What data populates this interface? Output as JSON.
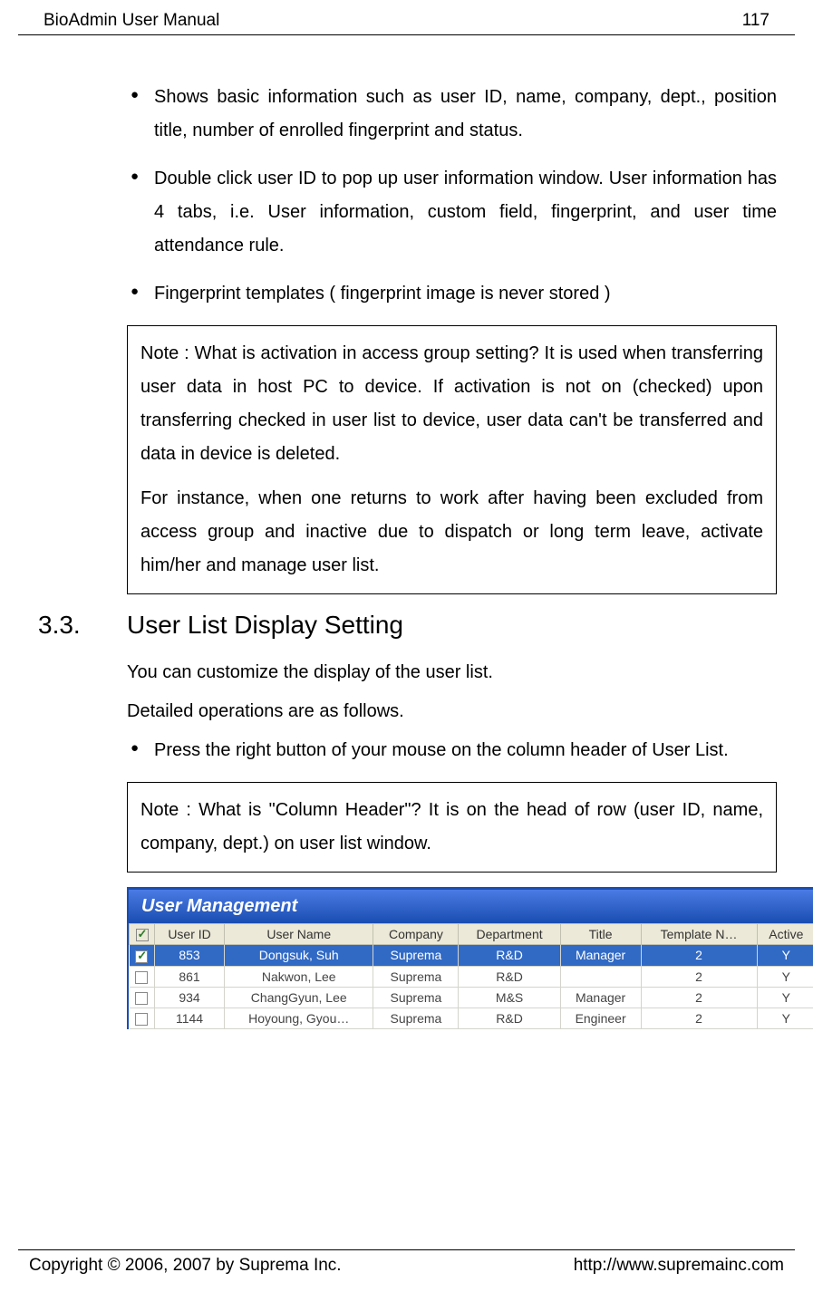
{
  "header": {
    "title": "BioAdmin  User  Manual",
    "page_number": "117"
  },
  "bullets_top": [
    "Shows basic information such as user ID, name, company, dept., position title, number of enrolled fingerprint and status.",
    "Double click user ID to pop up user information window. User information has 4 tabs, i.e. User information, custom field, fingerprint, and user time attendance rule.",
    "Fingerprint templates ( fingerprint image is never stored )"
  ],
  "note1": {
    "p1": "Note : What is activation in access group setting? It is used when transferring user data in host PC to device. If activation is not on (checked) upon transferring checked in user list to device, user data can't be transferred and data in device is deleted.",
    "p2": "For instance, when one returns to work after having been excluded from access group and inactive due to dispatch or long term leave, activate him/her and manage user list."
  },
  "section": {
    "num": "3.3.",
    "title": "User List Display Setting"
  },
  "body1": "You can customize the display of the user list.",
  "body2": "Detailed operations are as follows.",
  "bullet_mid": "Press the right button of your mouse on the column header of User List.",
  "note2": {
    "p1": "Note : What is \"Column Header\"? It is on the head of row (user ID, name, company, dept.) on user list window."
  },
  "screenshot": {
    "title": "User Management",
    "columns": [
      "",
      "User ID",
      "User Name",
      "Company",
      "Department",
      "Title",
      "Template N…",
      "Active"
    ],
    "rows": [
      {
        "checked": true,
        "selected": true,
        "user_id": "853",
        "user_name": "Dongsuk, Suh",
        "company": "Suprema",
        "department": "R&D",
        "title": "Manager",
        "template": "2",
        "active": "Y"
      },
      {
        "checked": false,
        "selected": false,
        "user_id": "861",
        "user_name": "Nakwon, Lee",
        "company": "Suprema",
        "department": "R&D",
        "title": "",
        "template": "2",
        "active": "Y"
      },
      {
        "checked": false,
        "selected": false,
        "user_id": "934",
        "user_name": "ChangGyun, Lee",
        "company": "Suprema",
        "department": "M&S",
        "title": "Manager",
        "template": "2",
        "active": "Y"
      },
      {
        "checked": false,
        "selected": false,
        "user_id": "1144",
        "user_name": "Hoyoung, Gyou…",
        "company": "Suprema",
        "department": "R&D",
        "title": "Engineer",
        "template": "2",
        "active": "Y"
      }
    ]
  },
  "footer": {
    "copyright": "Copyright © 2006, 2007 by Suprema Inc.",
    "url": "http://www.supremainc.com"
  }
}
